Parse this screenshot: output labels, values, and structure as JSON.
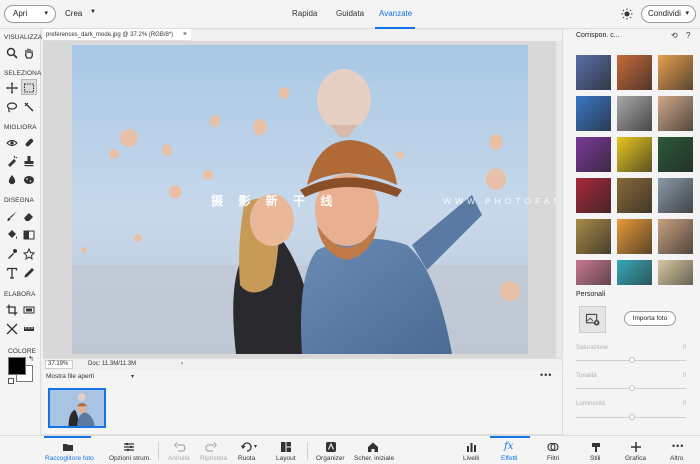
{
  "topbar": {
    "open_label": "Apri",
    "create_label": "Crea",
    "modes": [
      "Rapida",
      "Guidata",
      "Avanzate"
    ],
    "active_mode": "Avanzate",
    "share_label": "Condividi"
  },
  "toolbar": {
    "sections": {
      "view": "VISUALIZZA",
      "select": "SELEZIONA",
      "enhance": "MIGLIORA",
      "draw": "DISEGNA",
      "modify": "ELABORA",
      "color": "COLORE"
    }
  },
  "document": {
    "tab_title": "preferences_dark_mode.jpg @ 37.2% (RGB/8*)",
    "zoom": "37.19%",
    "doc_size": "Doc: 11.3M/11.3M",
    "watermark": "摄 影 新 干 线",
    "watermark_latin": "WWW.PHOTOFANS.VIP"
  },
  "photo_bin": {
    "label": "Mostra file aperti"
  },
  "right_panel": {
    "title": "Corrispon. c...",
    "personal_label": "Personali",
    "import_label": "Importa foto",
    "sliders": [
      {
        "label": "Saturazione",
        "value": "0"
      },
      {
        "label": "Tonalità",
        "value": "0"
      },
      {
        "label": "Luminosità",
        "value": "0"
      }
    ],
    "thumb_colors": [
      [
        "#5a6fa8",
        "#c86a3a",
        "#e8a050"
      ],
      [
        "#3a78c8",
        "#a8a8a8",
        "#d0a888"
      ],
      [
        "#7a3a9a",
        "#e8c820",
        "#2a5a3a"
      ],
      [
        "#a8283a",
        "#8a6a3a",
        "#8a9aa8"
      ],
      [
        "#a88a48",
        "#e89a38",
        "#c8a080"
      ],
      [
        "#c87890",
        "#38a8b8",
        "#d8c8a0"
      ]
    ]
  },
  "bottombar": {
    "items": [
      {
        "label": "Raccoglitore foto",
        "icon": "photo-bin-icon",
        "state": "active"
      },
      {
        "label": "Opzioni strum.",
        "icon": "tool-options-icon",
        "state": "normal"
      },
      {
        "label": "Annulla",
        "icon": "undo-icon",
        "state": "disabled"
      },
      {
        "label": "Ripristina",
        "icon": "redo-icon",
        "state": "disabled"
      },
      {
        "label": "Ruota",
        "icon": "rotate-icon",
        "state": "normal"
      },
      {
        "label": "Layout",
        "icon": "layout-icon",
        "state": "normal"
      },
      {
        "label": "Organizer",
        "icon": "organizer-icon",
        "state": "normal"
      },
      {
        "label": "Scher. iniziale",
        "icon": "home-icon",
        "state": "normal"
      },
      {
        "label": "Livelli",
        "icon": "layers-icon",
        "state": "normal"
      },
      {
        "label": "Effetti",
        "icon": "fx-icon",
        "state": "active"
      },
      {
        "label": "Filtri",
        "icon": "filters-icon",
        "state": "normal"
      },
      {
        "label": "Stili",
        "icon": "styles-icon",
        "state": "normal"
      },
      {
        "label": "Grafica",
        "icon": "graphics-icon",
        "state": "normal"
      },
      {
        "label": "Altro",
        "icon": "more-icon",
        "state": "normal"
      }
    ]
  },
  "colors": {
    "accent": "#1473e6"
  }
}
